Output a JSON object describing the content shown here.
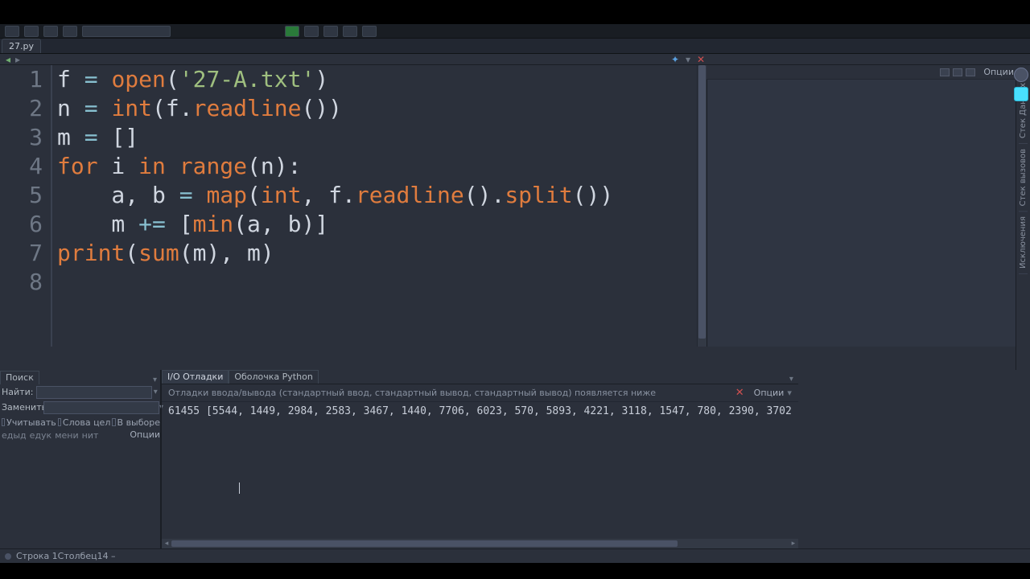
{
  "file_tab": "27.py",
  "editor": {
    "lines": [
      "1",
      "2",
      "3",
      "4",
      "5",
      "6",
      "7",
      "8"
    ],
    "code": {
      "l1": {
        "a": "f ",
        "b": "= ",
        "c": "open",
        "d": "(",
        "e": "'27-A.txt'",
        "f": ")"
      },
      "l2": {
        "a": "n ",
        "b": "= ",
        "c": "int",
        "d": "(f.",
        "e": "readline",
        "f": "())"
      },
      "l3": {
        "a": "m ",
        "b": "= ",
        "c": "[]"
      },
      "l4": {
        "a": "for",
        "b": " i ",
        "c": "in",
        "d": " ",
        "e": "range",
        "f": "(n):"
      },
      "l5": {
        "a": "    a, b ",
        "b": "= ",
        "c": "map",
        "d": "(",
        "e": "int",
        "f": ", f.",
        "g": "readline",
        "h": "().",
        "i": "split",
        "j": "())"
      },
      "l6": {
        "a": "    m ",
        "b": "+= ",
        "c": "[",
        "d": "min",
        "e": "(a, b)]"
      },
      "l7": {
        "a": "print",
        "b": "(",
        "c": "sum",
        "d": "(m), m)"
      }
    }
  },
  "right": {
    "options_label": "Опции",
    "side_labels": {
      "a": "Стек Данных",
      "b": "Стек вызовов",
      "c": "Исключения"
    }
  },
  "search": {
    "tab": "Поиск",
    "find_label": "Найти:",
    "find_value": "",
    "replace_label": "Заменить:",
    "replace_value": "",
    "check_case": "Учитывать",
    "check_word": "Слова цел",
    "check_sel": "В выборе",
    "btn_prev": "едыд",
    "btn_next": "едук",
    "btn_replace": "мени",
    "btn_all": "нит",
    "options": "Опции"
  },
  "debug": {
    "tab_io": "I/O Отладки",
    "tab_shell": "Оболочка Python",
    "header": "Отладки ввода/вывода (стандартный ввод, стандартный вывод, стандартный вывод) появляется ниже",
    "options": "Опции",
    "output": "61455 [5544, 1449, 2984, 2583, 3467, 1440, 7706, 6023, 570, 5893, 4221, 3118, 1547, 780, 2390, 3702"
  },
  "status": "Строка 1Столбец14 –"
}
